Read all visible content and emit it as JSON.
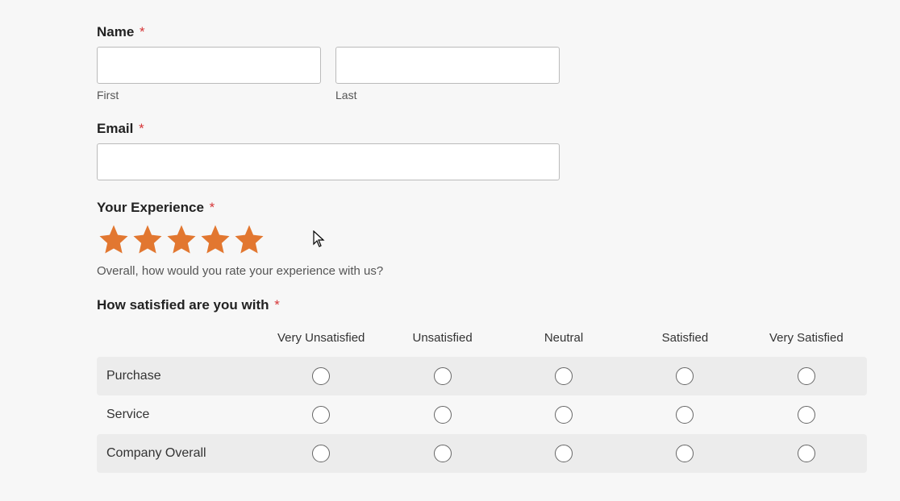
{
  "name": {
    "label": "Name",
    "first_sublabel": "First",
    "last_sublabel": "Last",
    "first_value": "",
    "last_value": ""
  },
  "email": {
    "label": "Email",
    "value": ""
  },
  "experience": {
    "label": "Your Experience",
    "rating": 5,
    "description": "Overall, how would you rate your experience with us?"
  },
  "satisfaction": {
    "label": "How satisfied are you with",
    "columns": [
      "Very Unsatisfied",
      "Unsatisfied",
      "Neutral",
      "Satisfied",
      "Very Satisfied"
    ],
    "rows": [
      "Purchase",
      "Service",
      "Company Overall"
    ]
  },
  "required_marker": "*"
}
